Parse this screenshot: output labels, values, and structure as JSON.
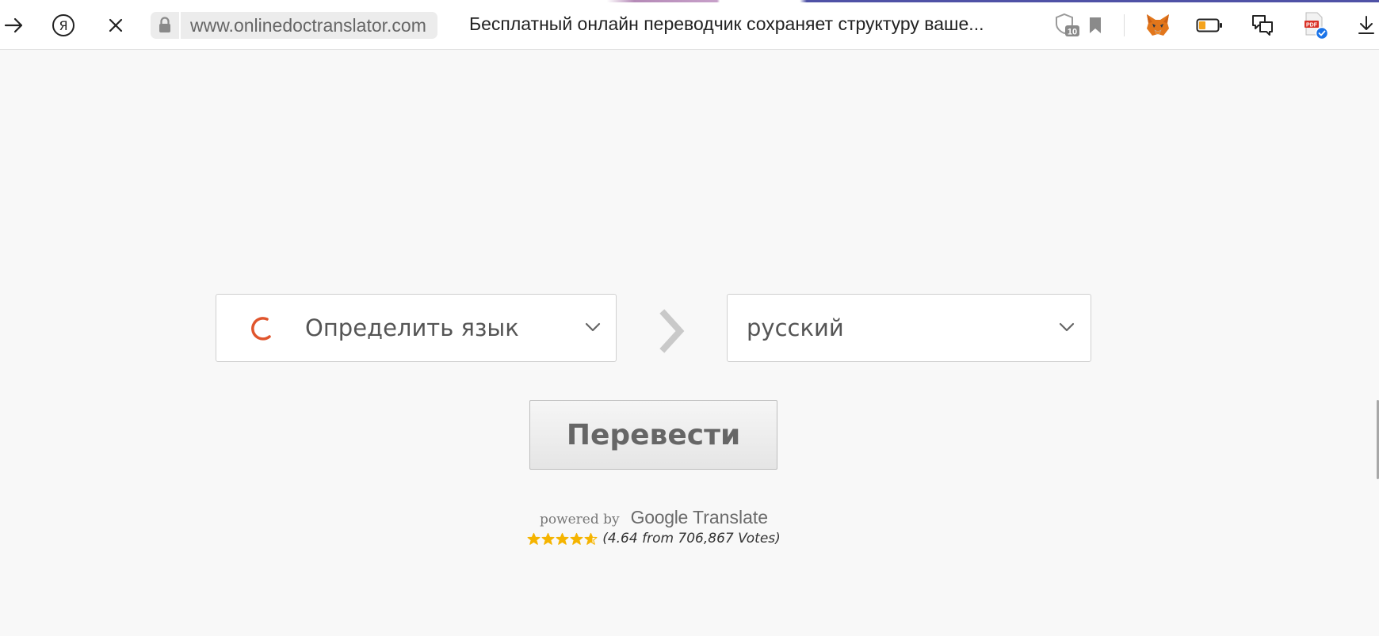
{
  "browser": {
    "url": "www.onlinedoctranslator.com",
    "page_title": "Бесплатный онлайн переводчик сохраняет структуру ваше...",
    "shield_badge": "10"
  },
  "translator": {
    "source_language": "Определить язык",
    "target_language": "русский",
    "translate_label": "Перевести",
    "powered_by": "powered by",
    "brand_google": "Google",
    "brand_translate": "Translate",
    "rating_text": "(4.64 from 706,867 Votes)",
    "rating_value": 4.64,
    "rating_max": 5
  },
  "colors": {
    "spinner": "#e0552d",
    "star": "#f5b400",
    "page_bg": "#f8f8f8"
  }
}
